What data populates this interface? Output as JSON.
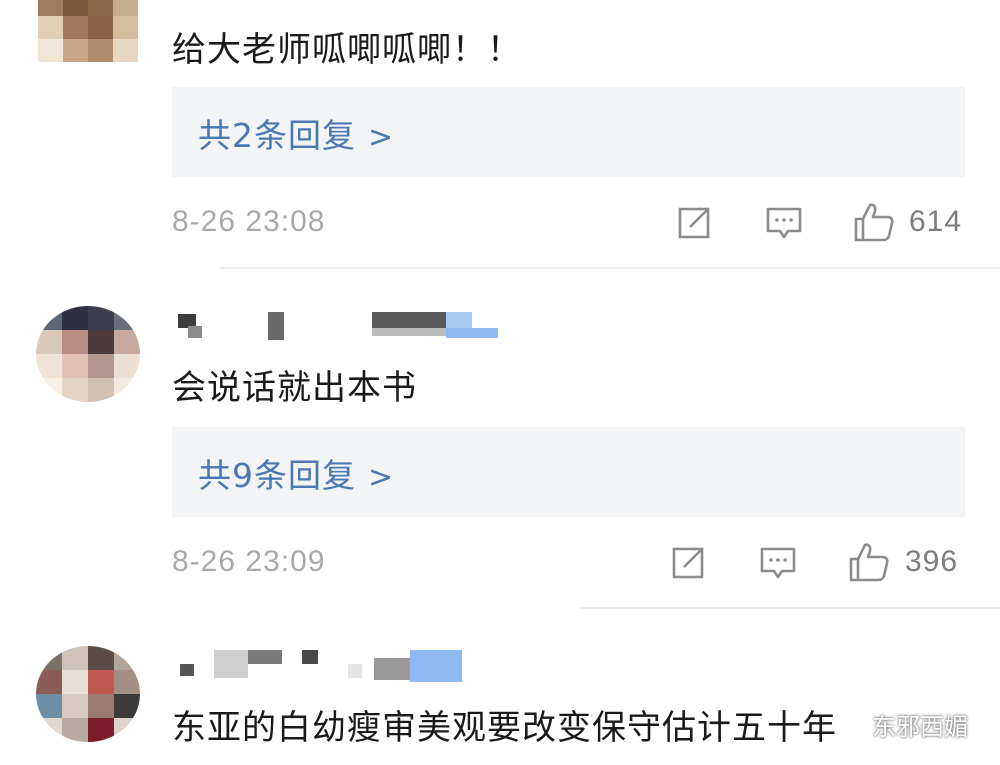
{
  "comments": [
    {
      "text": "给大老师呱唧呱唧！！",
      "replies_label": "共2条回复",
      "reply_arrow": ">",
      "time": "8-26 23:08",
      "likes": "614",
      "username_obscured": true
    },
    {
      "text": "会说话就出本书",
      "replies_label": "共9条回复",
      "reply_arrow": ">",
      "time": "8-26 23:09",
      "likes": "396",
      "username_obscured": true
    },
    {
      "text": "东亚的白幼瘦审美观要改变保守估计五十年",
      "username_obscured": true
    }
  ],
  "icons": {
    "share": "share-icon",
    "reply": "comment-icon",
    "like": "thumbs-up-icon",
    "watermark": "wechat-logo-icon"
  },
  "watermark": {
    "text": "东邪西媚"
  },
  "colors": {
    "reply_link": "#4a78b3",
    "reply_box_bg": "#f3f4f6",
    "meta_text": "#a9a9a9",
    "icon": "#8c8c8c",
    "name_highlight": "#8db8f0"
  }
}
